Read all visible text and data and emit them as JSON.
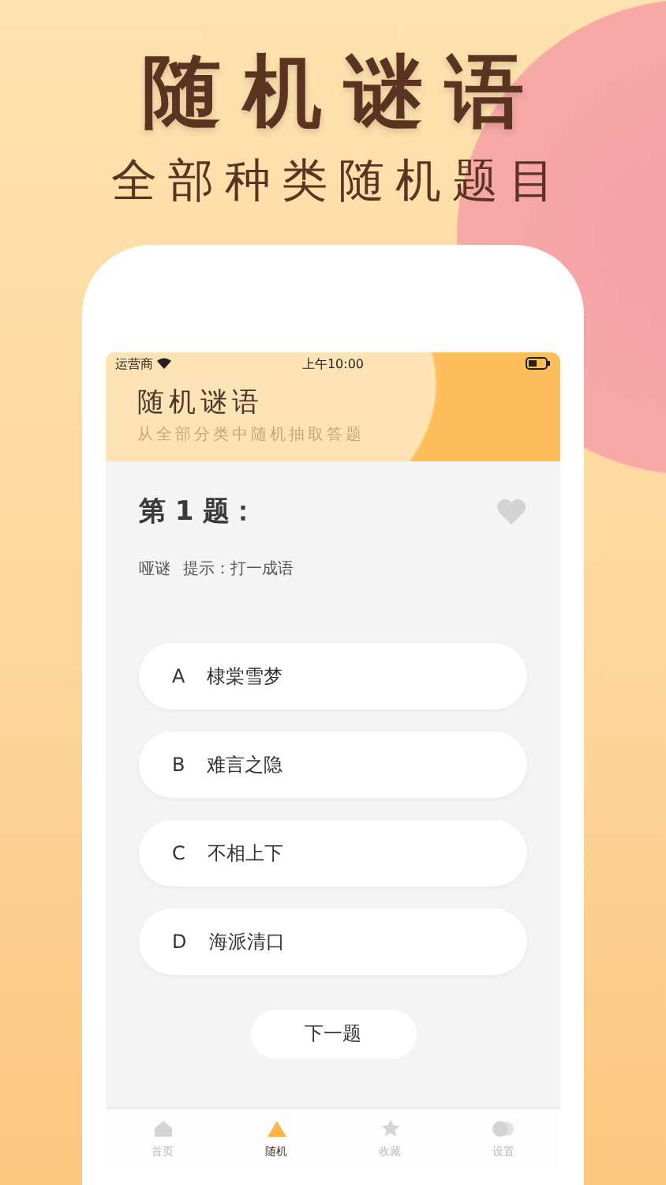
{
  "promo": {
    "title": "随机谜语",
    "subtitle": "全部种类随机题目"
  },
  "status_bar": {
    "carrier": "运营商",
    "time": "上午10:00"
  },
  "header": {
    "title": "随机谜语",
    "subtitle": "从全部分类中随机抽取答题"
  },
  "question": {
    "number": "第 1 题：",
    "favorite": false,
    "category": "哑谜",
    "hint": "提示：打一成语"
  },
  "options": [
    {
      "letter": "A",
      "text": "棣棠雪梦"
    },
    {
      "letter": "B",
      "text": "难言之隐"
    },
    {
      "letter": "C",
      "text": "不相上下"
    },
    {
      "letter": "D",
      "text": "海派清口"
    }
  ],
  "next_button": "下一题",
  "tabs": [
    {
      "kind": "home",
      "label": "首页",
      "selected": false
    },
    {
      "kind": "random",
      "label": "随机",
      "selected": true
    },
    {
      "kind": "favorites",
      "label": "收藏",
      "selected": false
    },
    {
      "kind": "settings",
      "label": "设置",
      "selected": false
    }
  ]
}
